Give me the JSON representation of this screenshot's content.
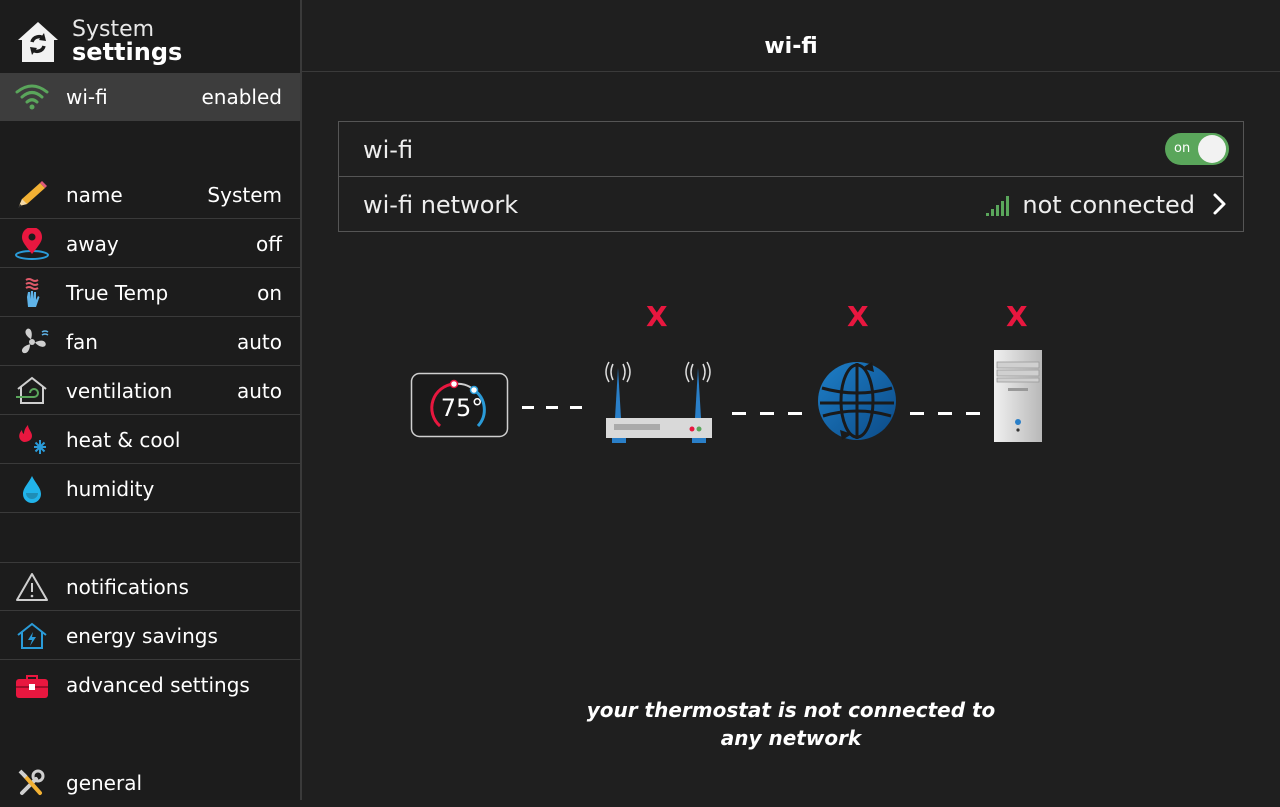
{
  "sidebar": {
    "title_line1": "System",
    "title_line2": "settings",
    "items": [
      {
        "icon": "wifi-icon",
        "label": "wi-fi",
        "value": "enabled"
      },
      {
        "icon": "pencil-icon",
        "label": "name",
        "value": "System"
      },
      {
        "icon": "location-pin-icon",
        "label": "away",
        "value": "off"
      },
      {
        "icon": "true-temp-hand-icon",
        "label": "True Temp",
        "value": "on"
      },
      {
        "icon": "fan-icon",
        "label": "fan",
        "value": "auto"
      },
      {
        "icon": "ventilation-house-icon",
        "label": "ventilation",
        "value": "auto"
      },
      {
        "icon": "flame-snowflake-icon",
        "label": "heat & cool",
        "value": ""
      },
      {
        "icon": "water-drop-icon",
        "label": "humidity",
        "value": ""
      },
      {
        "icon": "warning-triangle-icon",
        "label": "notifications",
        "value": ""
      },
      {
        "icon": "energy-house-icon",
        "label": "energy savings",
        "value": ""
      },
      {
        "icon": "toolbox-icon",
        "label": "advanced settings",
        "value": ""
      },
      {
        "icon": "tools-icon",
        "label": "general",
        "value": ""
      }
    ]
  },
  "main": {
    "title": "wi-fi",
    "wifi_row": {
      "label": "wi-fi",
      "toggle_label": "on",
      "toggle_state": true
    },
    "network_row": {
      "label": "wi-fi network",
      "status": "not connected",
      "signal_icon": "signal-bars-icon"
    },
    "diagram": {
      "thermostat_temp": "75°",
      "failure_mark": "X",
      "nodes": [
        "thermostat-icon",
        "router-icon",
        "globe-icon",
        "server-tower-icon"
      ]
    },
    "status_message": "your thermostat is not connected to any network"
  },
  "colors": {
    "accent_green": "#5aa65b",
    "error_red": "#e8173f",
    "active_row": "#3d3d3d",
    "background": "#1f1f1f"
  }
}
